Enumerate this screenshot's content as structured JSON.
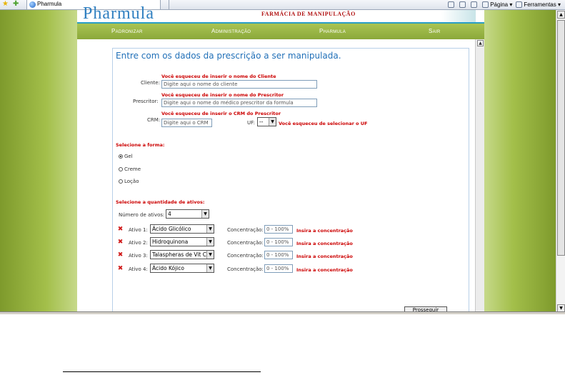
{
  "browser": {
    "tab_title": "Pharmula",
    "tools": [
      "Página",
      "Ferramentas"
    ]
  },
  "header": {
    "logo": "Pharmula",
    "tagline": "FARMÁCIA DE MANIPULAÇÃO"
  },
  "nav": {
    "items": [
      "Padronizar",
      "Administração",
      "Pharmula",
      "Sair"
    ]
  },
  "form": {
    "title": "Entre com os dados da prescrição a ser manipulada.",
    "cliente": {
      "label": "Cliente:",
      "error": "Você esqueceu de inserir o nome do Cliente",
      "placeholder": "Digite aqui o nome do cliente"
    },
    "prescritor": {
      "label": "Prescritor:",
      "error": "Você esqueceu de inserir o nome do Prescritor",
      "placeholder": "Digite aqui o nome do médico prescritor da formula"
    },
    "crm": {
      "label": "CRM:",
      "error": "Você esqueceu de inserir o CRM do Prescritor",
      "placeholder": "Digite aqui o CRM"
    },
    "uf": {
      "label": "UF:",
      "value": "--",
      "error": "Você esqueceu de selecionar o UF"
    },
    "forma": {
      "section": "Selecione a forma:",
      "options": [
        "Gel",
        "Creme",
        "Loção"
      ],
      "selected": "Gel"
    },
    "ativos": {
      "section": "Selecione a quantidade de ativos:",
      "count_label": "Número de ativos:",
      "count_value": "4",
      "conc_label": "Concentração:",
      "conc_placeholder": "0 - 100%",
      "conc_error": "Insira a concentração",
      "rows": [
        {
          "label": "Ativo 1:",
          "value": "Ácido Glicólico"
        },
        {
          "label": "Ativo 2:",
          "value": "Hidroquinona"
        },
        {
          "label": "Ativo 3:",
          "value": "Talaspheras de Vit C"
        },
        {
          "label": "Ativo 4:",
          "value": "Ácido Kójico"
        }
      ]
    },
    "submit_label": "Prosseguir"
  },
  "colors": {
    "accent_green": "#8ba83a",
    "title_blue": "#2170b8",
    "error_red": "#cc0000"
  }
}
